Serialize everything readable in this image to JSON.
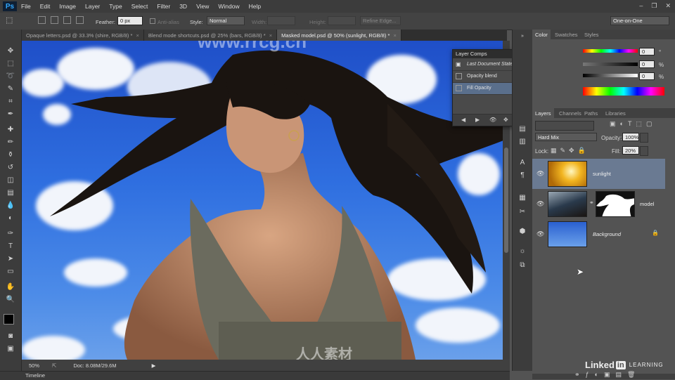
{
  "app": {
    "logo": "Ps"
  },
  "menu": [
    "File",
    "Edit",
    "Image",
    "Layer",
    "Type",
    "Select",
    "Filter",
    "3D",
    "View",
    "Window",
    "Help"
  ],
  "window_controls": {
    "minimize": "–",
    "restore": "❐",
    "close": "✕"
  },
  "options_bar": {
    "feather_label": "Feather:",
    "feather_value": "0 px",
    "antialias_label": "Anti-alias",
    "style_label": "Style:",
    "style_value": "Normal",
    "width_label": "Width:",
    "height_label": "Height:",
    "refine_edge": "Refine Edge...",
    "workspace": "One-on-One"
  },
  "doc_tabs": [
    {
      "label": "Opaque letters.psd @ 33.3% (shire, RGB/8) *",
      "active": false
    },
    {
      "label": "Blend mode shortcuts.psd @ 25% (bars, RGB/8) *",
      "active": false
    },
    {
      "label": "Masked model.psd @ 50% (sunlight, RGB/8) *",
      "active": true
    }
  ],
  "tab_close": "×",
  "status": {
    "zoom": "50%",
    "doc": "Doc: 8.08M/29.6M"
  },
  "timeline_label": "Timeline",
  "layer_comps": {
    "title": "Layer Comps",
    "rows": [
      {
        "label": "Last Document State",
        "italic": true
      },
      {
        "label": "Opacity blend",
        "italic": false
      },
      {
        "label": "Fill Opacity",
        "italic": false
      }
    ]
  },
  "color_panel": {
    "tabs": [
      "Color",
      "Swatches",
      "Styles"
    ],
    "values": [
      "0",
      "0",
      "0"
    ],
    "units": [
      "°",
      "%",
      "%"
    ]
  },
  "layers_panel": {
    "tabs": [
      "Layers",
      "Channels",
      "Paths",
      "Libraries"
    ],
    "blend_mode": "Hard Mix",
    "opacity_label": "Opacity:",
    "opacity_value": "100%",
    "lock_label": "Lock:",
    "fill_label": "Fill:",
    "fill_value": "20%",
    "layers": [
      {
        "name": "sunlight",
        "selected": true
      },
      {
        "name": "model",
        "selected": false
      },
      {
        "name": "Background",
        "selected": false
      }
    ]
  },
  "watermarks": {
    "top": "www.rrcg.cn",
    "bottom": "人人素材",
    "brand": "Linked",
    "brand_in": "in",
    "brand_learning": "LEARNING"
  }
}
